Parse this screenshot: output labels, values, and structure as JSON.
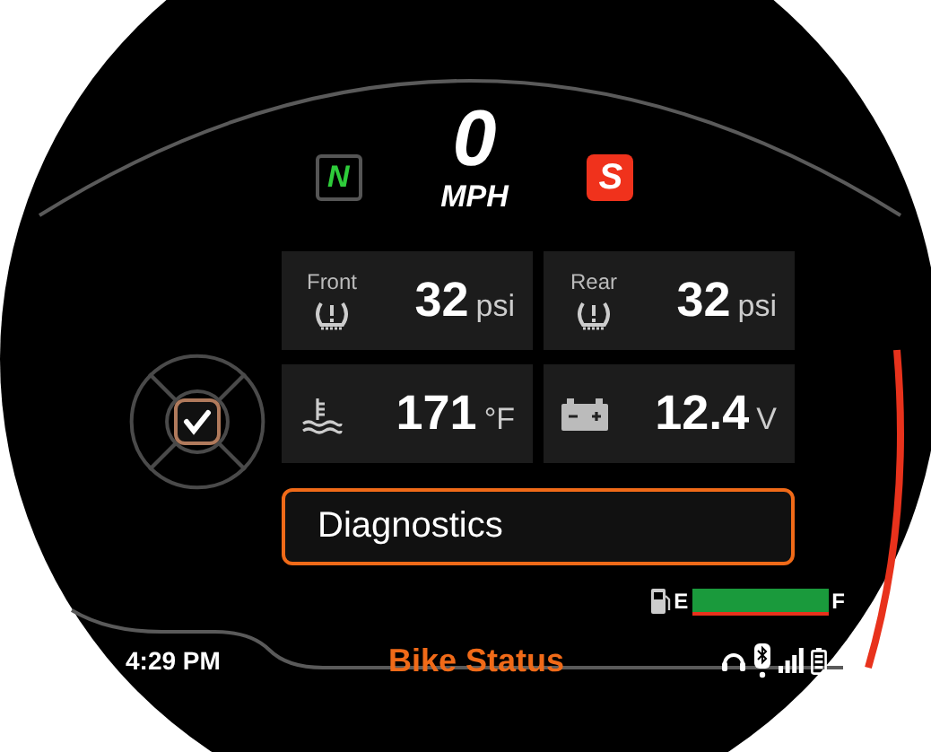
{
  "speed": {
    "value": "0",
    "unit": "MPH"
  },
  "gear": {
    "label": "N"
  },
  "ride_mode": {
    "label": "S"
  },
  "tiles": [
    {
      "kind": "tire",
      "label": "Front",
      "value": "32",
      "unit": "psi"
    },
    {
      "kind": "tire",
      "label": "Rear",
      "value": "32",
      "unit": "psi"
    },
    {
      "kind": "temperature",
      "value": "171",
      "unit": "°F"
    },
    {
      "kind": "battery",
      "value": "12.4",
      "unit": "V"
    }
  ],
  "action_button": {
    "label": "Diagnostics"
  },
  "fuel": {
    "empty_label": "E",
    "full_label": "F",
    "level": 1
  },
  "time": "4:29 PM",
  "screen_title": "Bike Status"
}
